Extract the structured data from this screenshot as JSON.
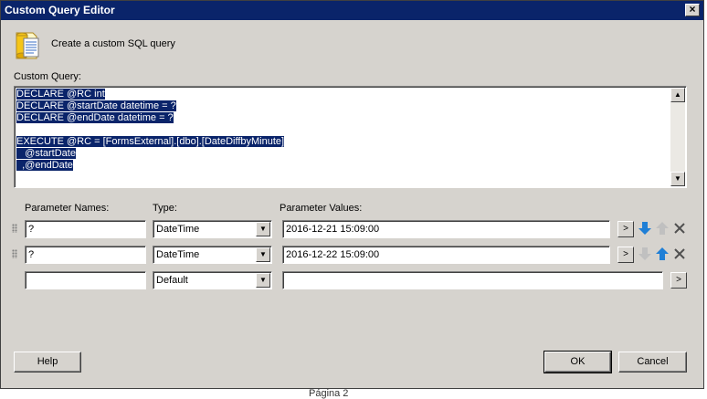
{
  "window": {
    "title": "Custom Query Editor",
    "close_label": "×"
  },
  "header": {
    "text": "Create a custom SQL query",
    "icon": "sql-query-icon"
  },
  "query": {
    "label": "Custom Query:",
    "lines": [
      "DECLARE @RC int",
      "DECLARE @startDate datetime = ?",
      "DECLARE @endDate datetime = ?",
      "",
      "EXECUTE @RC = [FormsExternal].[dbo].[DateDiffbyMinute]",
      "   @startDate",
      "  ,@endDate"
    ]
  },
  "params": {
    "col_names": "Parameter Names:",
    "col_type": "Type:",
    "col_values": "Parameter Values:",
    "rows": [
      {
        "name": "?",
        "type": "DateTime",
        "value": "2016-12-21 15:09:00"
      },
      {
        "name": "?",
        "type": "DateTime",
        "value": "2016-12-22 15:09:00"
      },
      {
        "name": "",
        "type": "Default",
        "value": ""
      }
    ],
    "browse_label": ">"
  },
  "buttons": {
    "help": "Help",
    "ok": "OK",
    "cancel": "Cancel"
  },
  "footer": {
    "text": "Página 2"
  },
  "colors": {
    "title_bg": "#0a246a",
    "dialog_bg": "#d6d3ce",
    "selection": "#0a246a",
    "arrow_blue": "#1f7fd6"
  }
}
